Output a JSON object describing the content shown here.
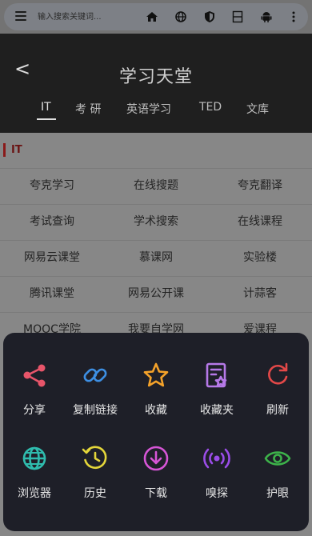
{
  "browser": {
    "search_placeholder": "输入搜索关键词..."
  },
  "header": {
    "back_label": "<",
    "title": "学习天堂",
    "tabs": [
      {
        "label": "IT"
      },
      {
        "label": "考 研"
      },
      {
        "label": "英语学习"
      },
      {
        "label": "TED"
      },
      {
        "label": "文库"
      }
    ]
  },
  "section": {
    "title": "IT",
    "items": [
      "夸克学习",
      "在线搜题",
      "夸克翻译",
      "考试查询",
      "学术搜索",
      "在线课程",
      "网易云课堂",
      "慕课网",
      "实验楼",
      "腾讯课堂",
      "网易公开课",
      "计蒜客",
      "MOOC学院",
      "我要自学网",
      "爱课程"
    ]
  },
  "sheet": {
    "actions": [
      {
        "label": "分享",
        "icon": "share-icon",
        "color": "#e8556a"
      },
      {
        "label": "复制链接",
        "icon": "link-icon",
        "color": "#3d8fe3"
      },
      {
        "label": "收藏",
        "icon": "star-icon",
        "color": "#f4a22a"
      },
      {
        "label": "收藏夹",
        "icon": "bookmark-folder-icon",
        "color": "#b679e8"
      },
      {
        "label": "刷新",
        "icon": "refresh-icon",
        "color": "#e34848"
      },
      {
        "label": "浏览器",
        "icon": "globe-icon",
        "color": "#2fbcae"
      },
      {
        "label": "历史",
        "icon": "history-icon",
        "color": "#e4d63a"
      },
      {
        "label": "下载",
        "icon": "download-icon",
        "color": "#d655d6"
      },
      {
        "label": "嗅探",
        "icon": "sniff-icon",
        "color": "#9b4de8"
      },
      {
        "label": "护眼",
        "icon": "eye-icon",
        "color": "#3db34a"
      }
    ]
  }
}
